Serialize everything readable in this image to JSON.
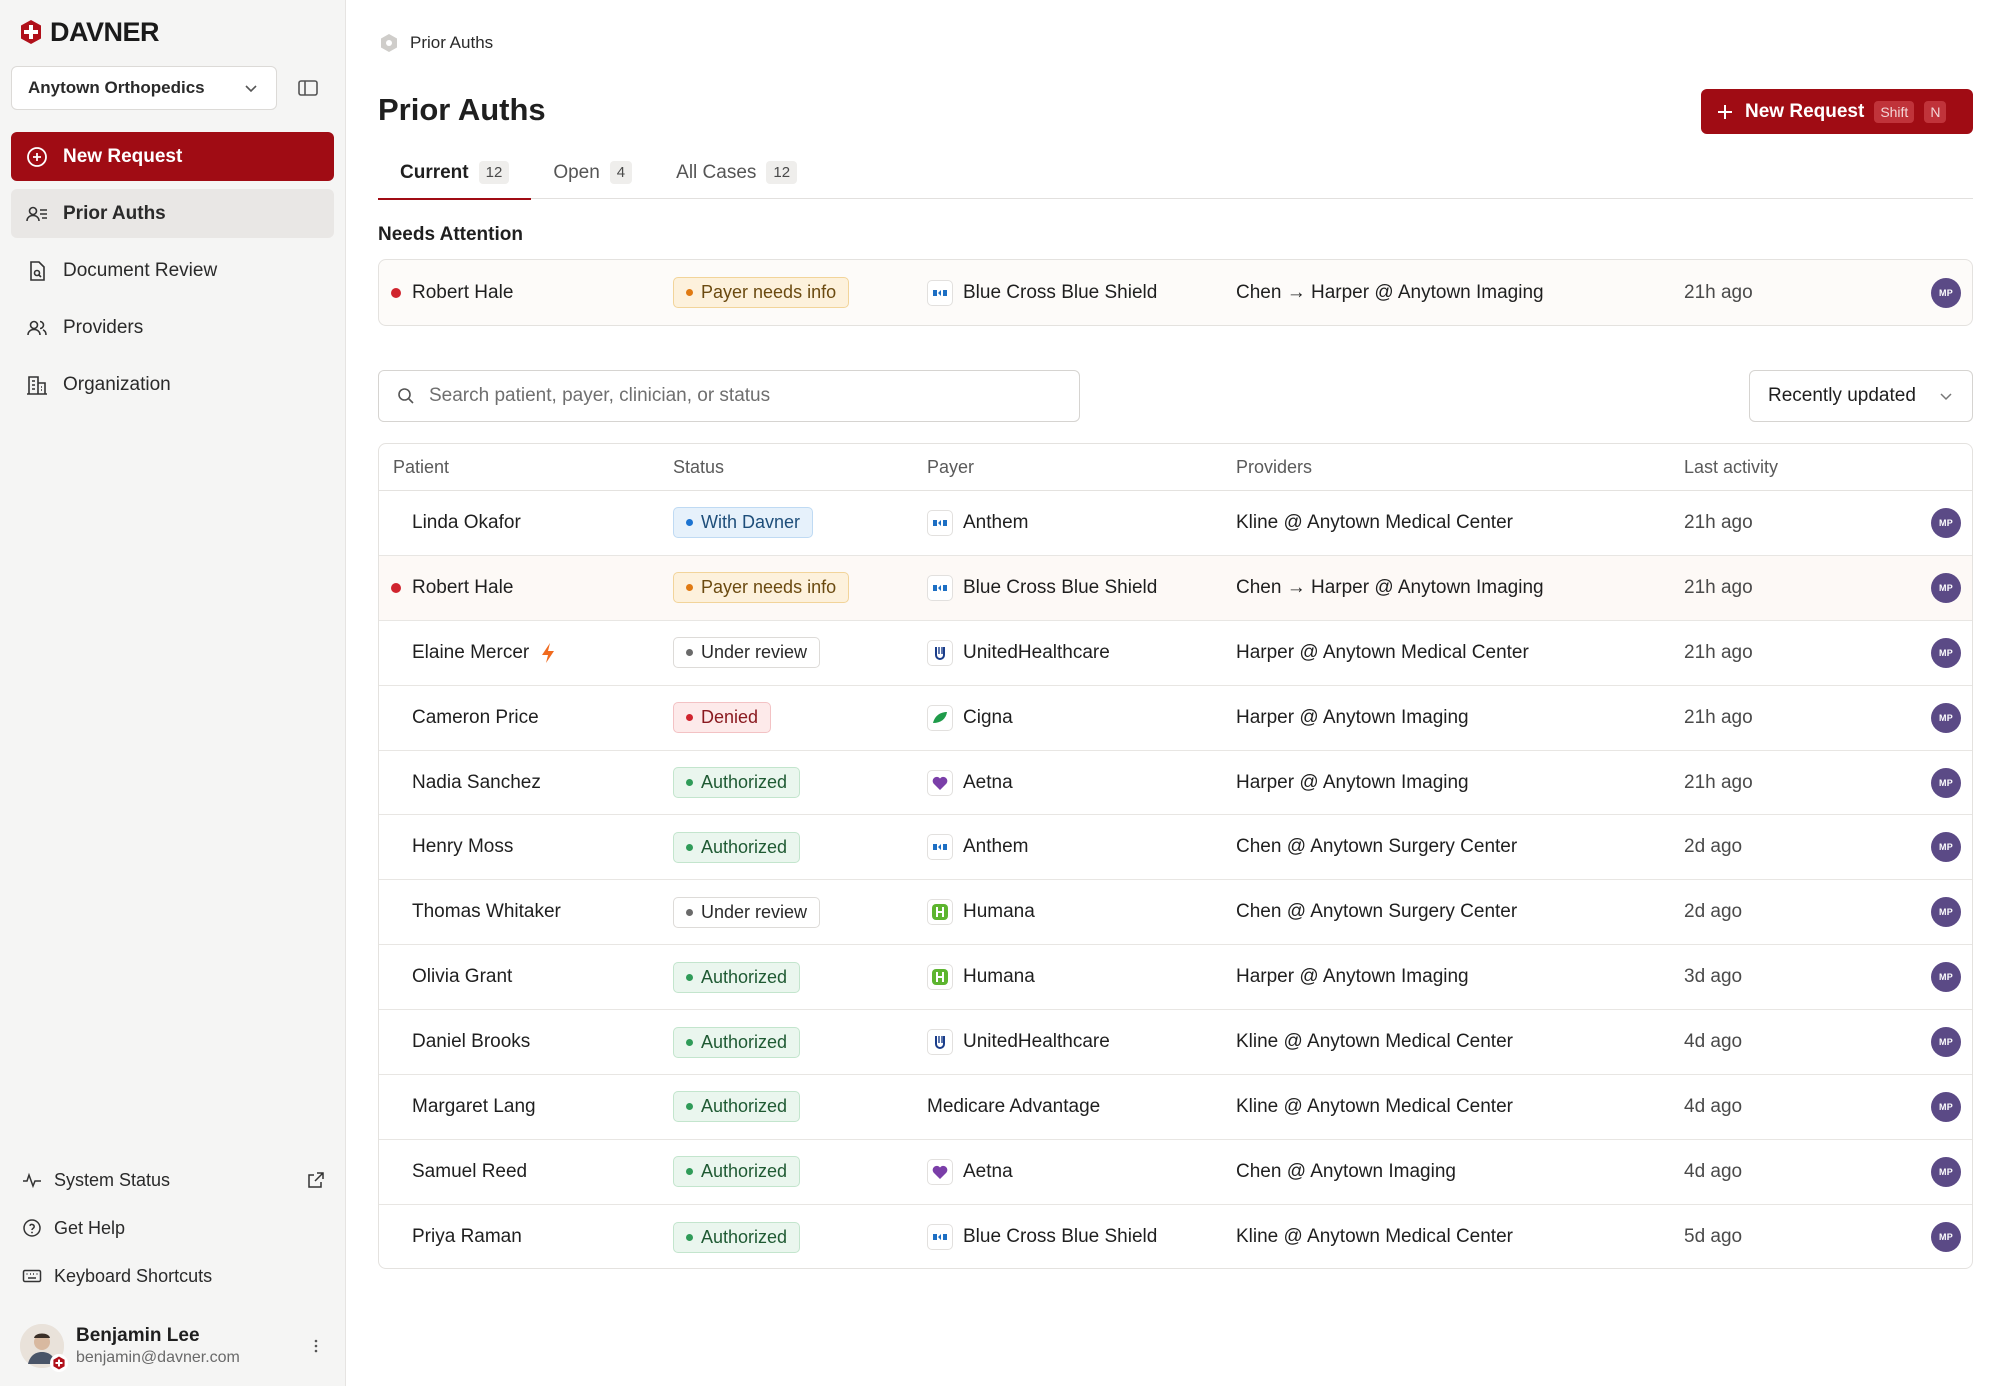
{
  "brand": {
    "name": "DAVNER",
    "accent": "#a00c14"
  },
  "sidebar": {
    "org": "Anytown Orthopedics",
    "items": [
      {
        "label": "New Request",
        "icon": "plus-circle-icon"
      },
      {
        "label": "Prior Auths",
        "icon": "user-list-icon"
      },
      {
        "label": "Document Review",
        "icon": "document-search-icon"
      },
      {
        "label": "Providers",
        "icon": "users-icon"
      },
      {
        "label": "Organization",
        "icon": "building-icon"
      }
    ],
    "bottom": [
      {
        "label": "System Status",
        "icon": "activity-icon"
      },
      {
        "label": "Get Help",
        "icon": "help-circle-icon"
      },
      {
        "label": "Keyboard Shortcuts",
        "icon": "keyboard-icon"
      }
    ],
    "user": {
      "name": "Benjamin Lee",
      "email": "benjamin@davner.com"
    }
  },
  "header": {
    "breadcrumb": "Prior Auths",
    "title": "Prior Auths",
    "new_button": {
      "label": "New Request",
      "kbd1": "Shift",
      "kbd2": "N"
    }
  },
  "tabs": [
    {
      "label": "Current",
      "count": "12"
    },
    {
      "label": "Open",
      "count": "4"
    },
    {
      "label": "All Cases",
      "count": "12"
    }
  ],
  "attention": {
    "label": "Needs Attention",
    "row": {
      "patient": "Robert Hale",
      "status": "Payer needs info",
      "payer": "Blue Cross Blue Shield",
      "providers": "Chen → Harper @ Anytown Imaging",
      "activity": "21h ago",
      "owner": "MP"
    }
  },
  "search": {
    "placeholder": "Search patient, payer, clinician, or status"
  },
  "sort": {
    "value": "Recently updated"
  },
  "table": {
    "headers": {
      "patient": "Patient",
      "status": "Status",
      "payer": "Payer",
      "providers": "Providers",
      "activity": "Last activity"
    },
    "rows": [
      {
        "patient": "Linda Okafor",
        "status": "With Davner",
        "payer": "Anthem",
        "providers": "Kline @ Anytown Medical Center",
        "activity": "21h ago",
        "owner": "MP"
      },
      {
        "patient": "Robert Hale",
        "status": "Payer needs info",
        "payer": "Blue Cross Blue Shield",
        "providers": "Chen → Harper @ Anytown Imaging",
        "activity": "21h ago",
        "owner": "MP"
      },
      {
        "patient": "Elaine Mercer",
        "status": "Under review",
        "payer": "UnitedHealthcare",
        "providers": "Harper @ Anytown Medical Center",
        "activity": "21h ago",
        "owner": "MP"
      },
      {
        "patient": "Cameron Price",
        "status": "Denied",
        "payer": "Cigna",
        "providers": "Harper @ Anytown Imaging",
        "activity": "21h ago",
        "owner": "MP"
      },
      {
        "patient": "Nadia Sanchez",
        "status": "Authorized",
        "payer": "Aetna",
        "providers": "Harper @ Anytown Imaging",
        "activity": "21h ago",
        "owner": "MP"
      },
      {
        "patient": "Henry Moss",
        "status": "Authorized",
        "payer": "Anthem",
        "providers": "Chen @ Anytown Surgery Center",
        "activity": "2d ago",
        "owner": "MP"
      },
      {
        "patient": "Thomas Whitaker",
        "status": "Under review",
        "payer": "Humana",
        "providers": "Chen @ Anytown Surgery Center",
        "activity": "2d ago",
        "owner": "MP"
      },
      {
        "patient": "Olivia Grant",
        "status": "Authorized",
        "payer": "Humana",
        "providers": "Harper @ Anytown Imaging",
        "activity": "3d ago",
        "owner": "MP"
      },
      {
        "patient": "Daniel Brooks",
        "status": "Authorized",
        "payer": "UnitedHealthcare",
        "providers": "Kline @ Anytown Medical Center",
        "activity": "4d ago",
        "owner": "MP"
      },
      {
        "patient": "Margaret Lang",
        "status": "Authorized",
        "payer": "Medicare Advantage",
        "providers": "Kline @ Anytown Medical Center",
        "activity": "4d ago",
        "owner": "MP"
      },
      {
        "patient": "Samuel Reed",
        "status": "Authorized",
        "payer": "Aetna",
        "providers": "Chen @ Anytown Imaging",
        "activity": "4d ago",
        "owner": "MP"
      },
      {
        "patient": "Priya Raman",
        "status": "Authorized",
        "payer": "Blue Cross Blue Shield",
        "providers": "Kline @ Anytown Medical Center",
        "activity": "5d ago",
        "owner": "MP"
      }
    ]
  }
}
